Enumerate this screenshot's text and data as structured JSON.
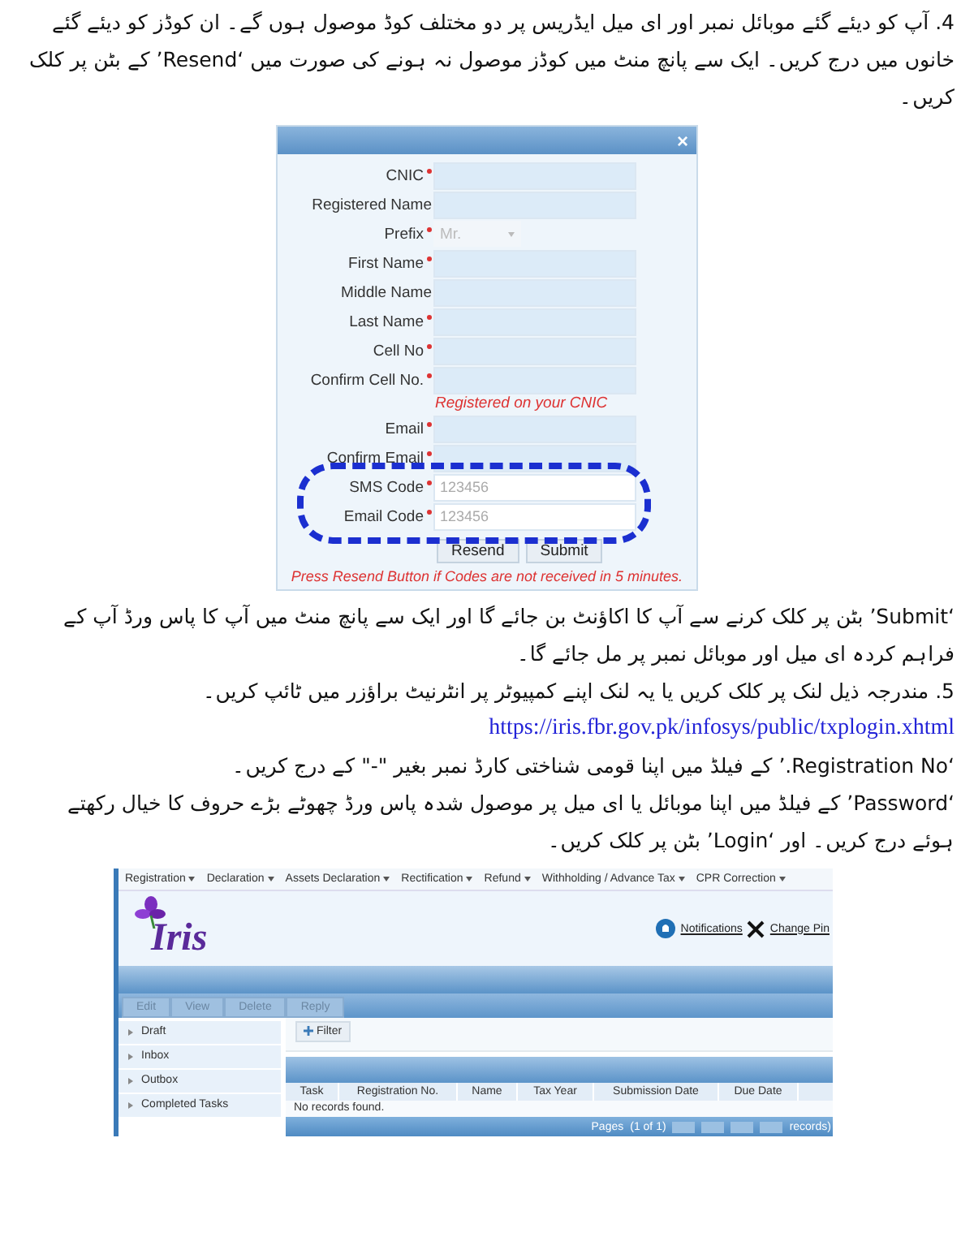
{
  "intro": "4. آپ کو دیئے گئے موبائل نمبر اور ای میل ایڈریس پر دو مختلف کوڈ موصول ہوں گے۔ ان کوڈز کو دیئے گئے خانوں میں درج کریں۔ ایک سے پانچ منٹ میں کوڈز موصول نہ ہونے کی صورت میں ‘Resend’ کے بٹن پر کلک کریں۔",
  "dialog": {
    "close": "×",
    "fields": [
      {
        "label": "CNIC",
        "required": true,
        "kind": "input",
        "highlighted": false
      },
      {
        "label": "Registered Name",
        "required": false,
        "kind": "input",
        "highlighted": false
      },
      {
        "label": "Prefix",
        "required": true,
        "kind": "select",
        "placeholder": "Mr.",
        "highlighted": false
      },
      {
        "label": "First Name",
        "required": true,
        "kind": "input",
        "highlighted": false
      },
      {
        "label": "Middle Name",
        "required": false,
        "kind": "input",
        "highlighted": false
      },
      {
        "label": "Last Name",
        "required": true,
        "kind": "input",
        "highlighted": false
      },
      {
        "label": "Cell No",
        "required": true,
        "kind": "input",
        "highlighted": false
      },
      {
        "label": "Confirm Cell No.",
        "required": true,
        "kind": "input",
        "hint": "Registered on your CNIC",
        "highlighted": false
      },
      {
        "label": "Email",
        "required": true,
        "kind": "input",
        "highlighted": false
      },
      {
        "label": "Confirm Email",
        "required": true,
        "kind": "input",
        "highlighted": false
      },
      {
        "label": "SMS Code",
        "required": true,
        "kind": "input",
        "placeholder": "123456",
        "highlighted": true
      },
      {
        "label": "Email Code",
        "required": true,
        "kind": "input",
        "placeholder": "123456",
        "highlighted": true
      }
    ],
    "buttons": [
      "Resend",
      "Submit"
    ],
    "footer": "Press Resend Button if Codes are not received in 5 minutes."
  },
  "paragraphs": [
    {
      "kind": "text",
      "text": "‘Submit’ بٹن پر کلک کرنے سے آپ کا اکاؤنٹ بن جائے گا اور ایک سے پانچ منٹ میں آپ کا پاس ورڈ آپ کے فراہم کردہ ای میل اور موبائل نمبر پر مل جائے گا۔"
    },
    {
      "kind": "text",
      "text": "5. مندرجہ ذیل لنک پر کلک کریں یا یہ لنک اپنے کمپیوٹر پر انٹرنیٹ براؤزر میں ٹائپ کریں۔"
    },
    {
      "kind": "link",
      "text": "https://iris.fbr.gov.pk/infosys/public/txplogin.xhtml"
    },
    {
      "kind": "text",
      "text": "‘Registration No.’ کے فیلڈ میں اپنا قومی شناختی کارڈ نمبر بغیر \"-\" کے درج کریں۔"
    },
    {
      "kind": "text",
      "text": "‘Password’ کے فیلڈ میں اپنا موبائل یا ای میل پر موصول شدہ پاس ورڈ چھوٹے بڑے حروف کا خیال رکھتے ہوئے درج کریں۔ اور ‘Login’ بٹن پر کلک کریں۔"
    }
  ],
  "iris": {
    "menu": [
      "Registration",
      "Declaration",
      "Assets Declaration",
      "Rectification",
      "Refund",
      "Withholding / Advance Tax",
      "CPR Correction"
    ],
    "logo_text": "Iris",
    "header_links": [
      {
        "kind": "bell",
        "label": "Notifications"
      },
      {
        "kind": "tools",
        "label": "Change Pin"
      }
    ],
    "toolbar": [
      {
        "label": "Edit",
        "disabled": true
      },
      {
        "label": "View",
        "disabled": true
      },
      {
        "label": "Delete",
        "disabled": true
      },
      {
        "label": "Reply",
        "disabled": true
      }
    ],
    "sidebar": {
      "items": [
        {
          "label": "Draft"
        },
        {
          "label": "Inbox"
        },
        {
          "label": "Outbox"
        },
        {
          "label": "Completed Tasks"
        }
      ]
    },
    "filter": "Filter",
    "table": {
      "columns": [
        "Task",
        "Registration No.",
        "Name",
        "Tax Year",
        "Submission Date",
        "Due Date"
      ],
      "empty": "No records found."
    },
    "pager": {
      "label": "Pages",
      "status": "(1 of 1)",
      "records": "records)"
    }
  }
}
